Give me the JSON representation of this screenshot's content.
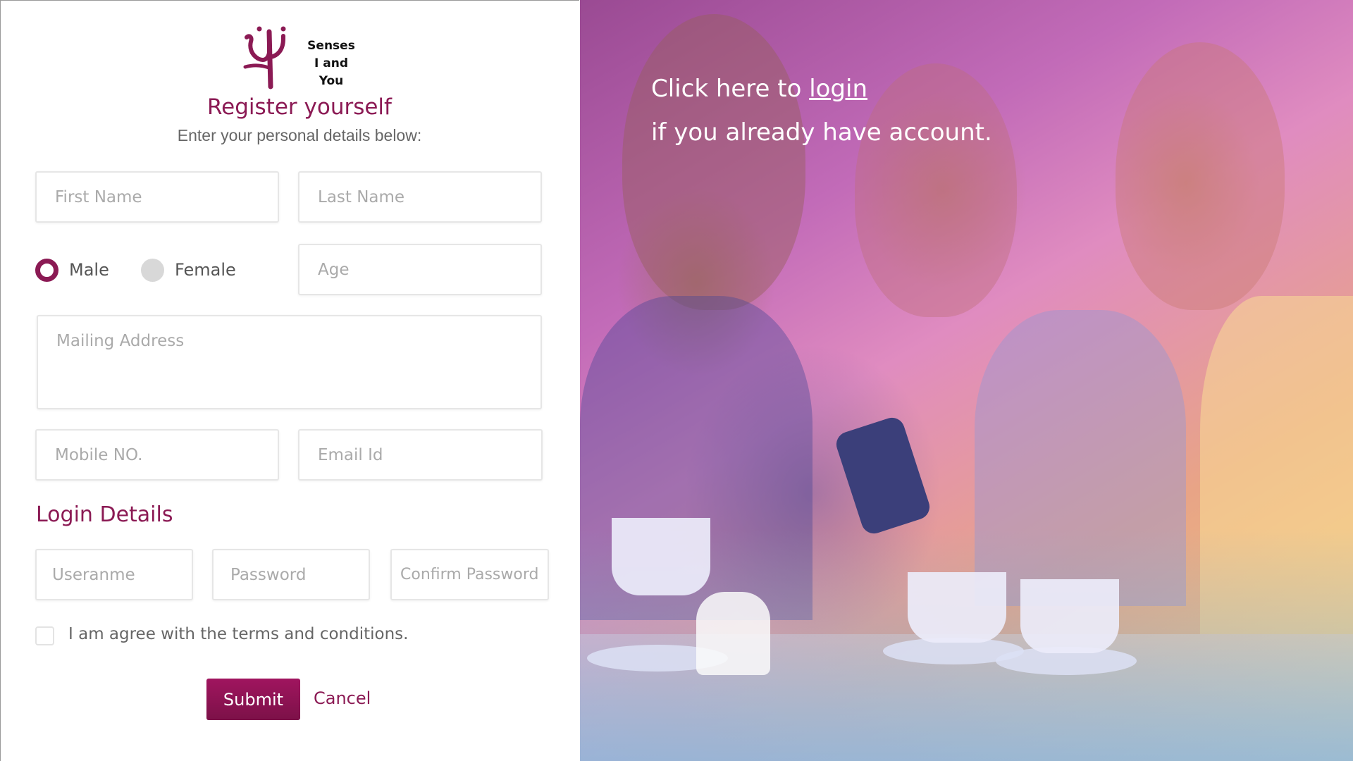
{
  "brand": {
    "logo_icon": "psi-icon",
    "logo_line1": "Senses",
    "logo_line2": "I and You",
    "accent_color": "#8b1a54"
  },
  "form": {
    "title": "Register yourself",
    "subtitle": "Enter your personal details below:",
    "first_name_placeholder": "First Name",
    "last_name_placeholder": "Last Name",
    "gender_male": "Male",
    "gender_female": "Female",
    "gender_selected": "Male",
    "age_placeholder": "Age",
    "address_placeholder": "Mailing Address",
    "mobile_placeholder": "Mobile NO.",
    "email_placeholder": "Email Id"
  },
  "login_details": {
    "title": "Login Details",
    "username_placeholder": "Useranme",
    "password_placeholder": "Password",
    "confirm_password_placeholder": "Confirm Password"
  },
  "terms": {
    "label": "I am agree with the terms and conditions.",
    "checked": false
  },
  "actions": {
    "submit_label": "Submit",
    "cancel_label": "Cancel"
  },
  "login_prompt": {
    "prefix": "Click here to ",
    "link": "login",
    "line2": "if you already have account."
  }
}
